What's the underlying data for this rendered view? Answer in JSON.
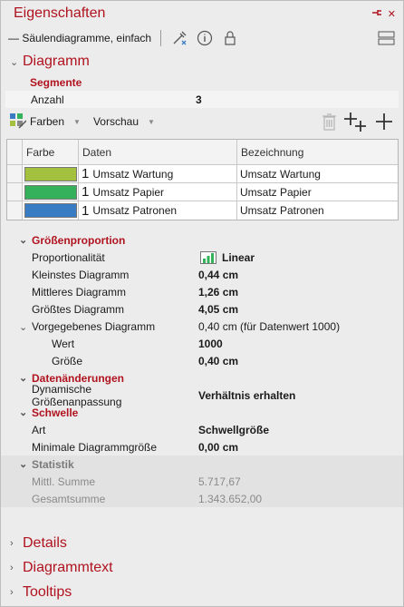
{
  "window": {
    "title": "Eigenschaften",
    "pin": "ᐩ",
    "close": "✕"
  },
  "toolbar": {
    "object_name": "Säulendiagramme, einfach"
  },
  "diagramm": {
    "header": "Diagramm",
    "segmente": {
      "header": "Segmente",
      "anzahl_label": "Anzahl",
      "anzahl_value": "3"
    },
    "actions": {
      "farben_label": "Farben",
      "vorschau_label": "Vorschau"
    },
    "table": {
      "columns": [
        "Farbe",
        "Daten",
        "Bezeichnung"
      ],
      "rows": [
        {
          "color": "#a3c13e",
          "num": "1",
          "data": "Umsatz Wartung",
          "label": "Umsatz Wartung"
        },
        {
          "color": "#34b15a",
          "num": "1",
          "data": "Umsatz Papier",
          "label": "Umsatz Papier"
        },
        {
          "color": "#3a7cc3",
          "num": "1",
          "data": "Umsatz Patronen",
          "label": "Umsatz Patronen"
        }
      ]
    },
    "groessen": {
      "header": "Größenproportion",
      "rows": [
        {
          "k": "Proportionalität",
          "v": "Linear"
        },
        {
          "k": "Kleinstes Diagramm",
          "v": "0,44 cm"
        },
        {
          "k": "Mittleres Diagramm",
          "v": "1,26 cm"
        },
        {
          "k": "Größtes Diagramm",
          "v": "4,05 cm"
        }
      ],
      "vorgegeben": {
        "k": "Vorgegebenes Diagramm",
        "v": "0,40 cm (für Datenwert 1000)"
      },
      "wert": {
        "k": "Wert",
        "v": "1000"
      },
      "groesse": {
        "k": "Größe",
        "v": "0,40 cm"
      }
    },
    "daten": {
      "header": "Datenänderungen",
      "k": "Dynamische Größenanpassung",
      "v": "Verhältnis erhalten"
    },
    "schwelle": {
      "header": "Schwelle",
      "art_k": "Art",
      "art_v": "Schwellgröße",
      "min_k": "Minimale Diagrammgröße",
      "min_v": "0,00 cm"
    },
    "statistik": {
      "header": "Statistik",
      "mittl_k": "Mittl. Summe",
      "mittl_v": "5.717,67",
      "gesamt_k": "Gesamtsumme",
      "gesamt_v": "1.343.652,00"
    }
  },
  "collapsed": {
    "details": "Details",
    "diagrammtext": "Diagrammtext",
    "tooltips": "Tooltips"
  },
  "colors": {
    "accent": "#b0131f"
  }
}
